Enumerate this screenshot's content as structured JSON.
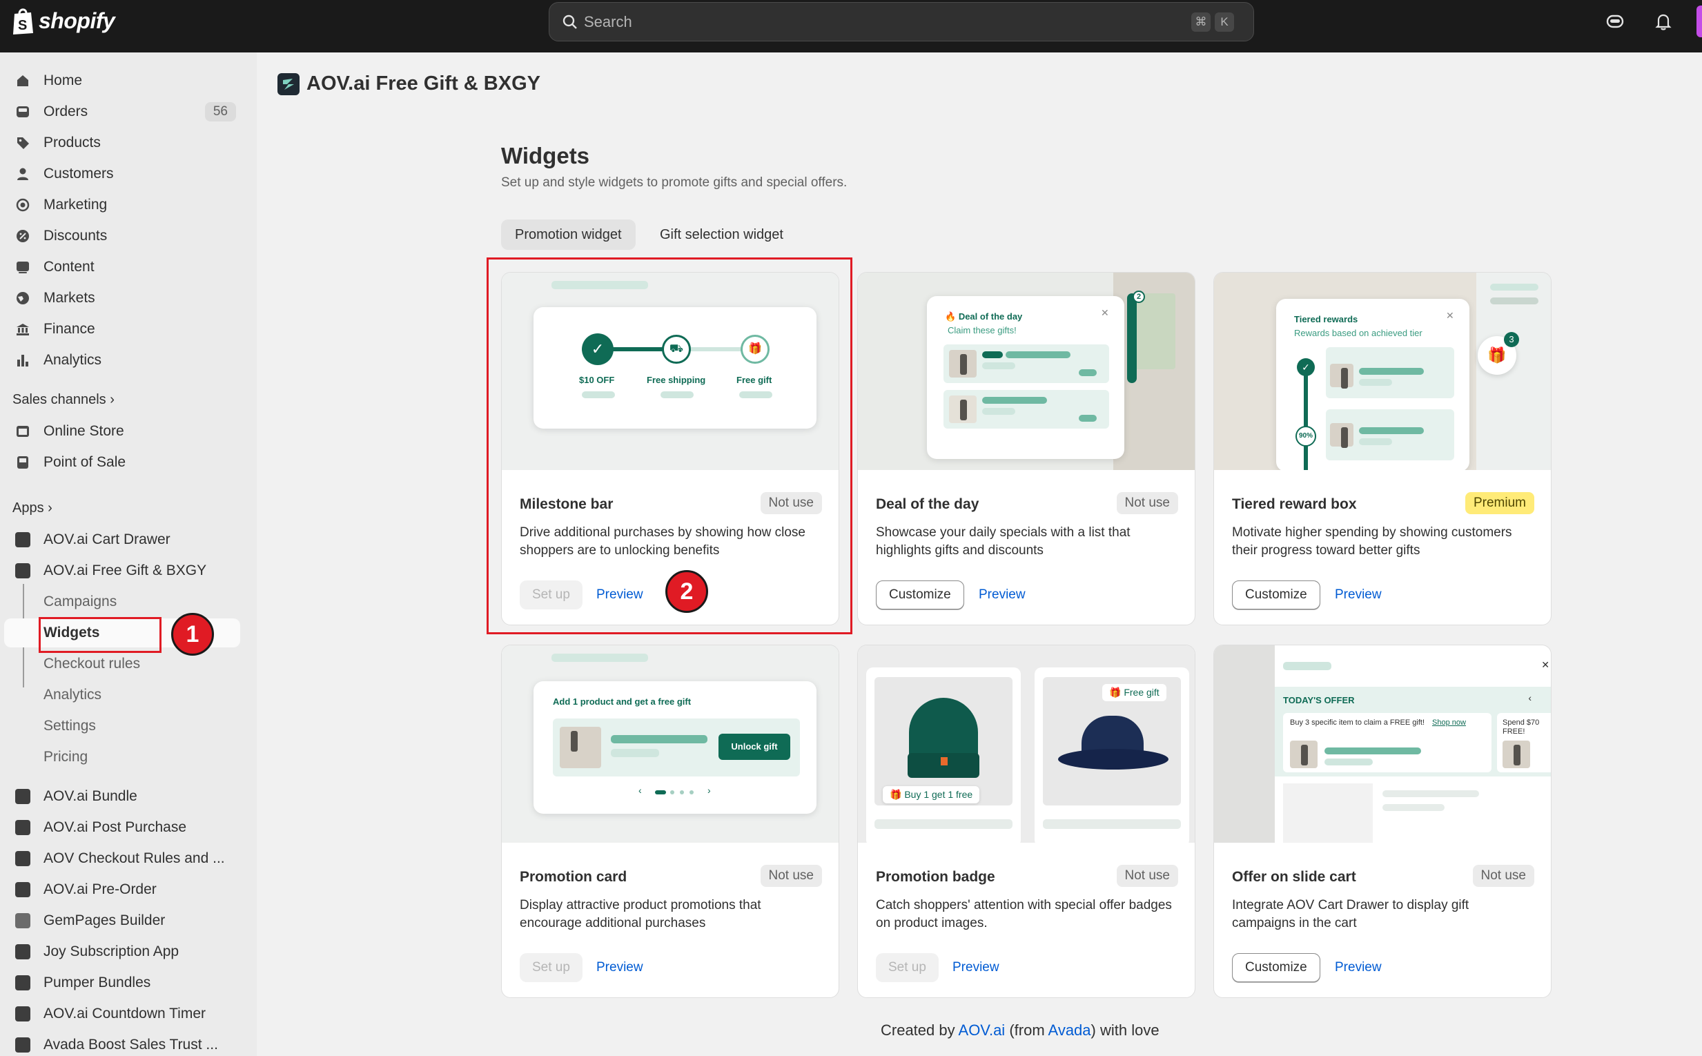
{
  "topbar": {
    "brand": "shopify",
    "search_placeholder": "Search",
    "shortcut_key1": "⌘",
    "shortcut_key2": "K"
  },
  "sidebar": {
    "main_items": [
      {
        "label": "Home",
        "icon": "home-icon"
      },
      {
        "label": "Orders",
        "icon": "inbox-icon",
        "count": "56"
      },
      {
        "label": "Products",
        "icon": "tag-icon"
      },
      {
        "label": "Customers",
        "icon": "person-icon"
      },
      {
        "label": "Marketing",
        "icon": "target-icon"
      },
      {
        "label": "Discounts",
        "icon": "discount-icon"
      },
      {
        "label": "Content",
        "icon": "content-icon"
      },
      {
        "label": "Markets",
        "icon": "globe-icon"
      },
      {
        "label": "Finance",
        "icon": "bank-icon"
      },
      {
        "label": "Analytics",
        "icon": "chart-bars-icon"
      }
    ],
    "sales_channels_label": "Sales channels",
    "sales_channels": [
      {
        "label": "Online Store"
      },
      {
        "label": "Point of Sale"
      }
    ],
    "apps_label": "Apps",
    "apps": [
      {
        "label": "AOV.ai Cart Drawer"
      },
      {
        "label": "AOV.ai Free Gift & BXGY"
      }
    ],
    "app_subitems": [
      {
        "label": "Campaigns"
      },
      {
        "label": "Widgets"
      },
      {
        "label": "Checkout rules"
      },
      {
        "label": "Analytics"
      },
      {
        "label": "Settings"
      },
      {
        "label": "Pricing"
      }
    ],
    "more_apps": [
      {
        "label": "AOV.ai Bundle"
      },
      {
        "label": "AOV.ai Post Purchase"
      },
      {
        "label": "AOV Checkout Rules and ..."
      },
      {
        "label": "AOV.ai Pre-Order"
      },
      {
        "label": "GemPages Builder"
      },
      {
        "label": "Joy Subscription App"
      },
      {
        "label": "Pumper Bundles"
      },
      {
        "label": "AOV.ai Countdown Timer"
      },
      {
        "label": "Avada Boost Sales Trust ..."
      }
    ]
  },
  "main": {
    "app_title": "AOV.ai Free Gift & BXGY",
    "heading": "Widgets",
    "subheading": "Set up and style widgets to promote gifts and special offers.",
    "tabs": [
      {
        "label": "Promotion widget",
        "selected": true
      },
      {
        "label": "Gift selection widget",
        "selected": false
      }
    ],
    "cards": [
      {
        "title": "Milestone bar",
        "status": "Not use",
        "description": "Drive additional purchases by showing how close shoppers are to unlocking benefits",
        "primary": "Set up",
        "primary_enabled": false,
        "secondary": "Preview"
      },
      {
        "title": "Deal of the day",
        "status": "Not use",
        "description": "Showcase your daily specials with a list that highlights gifts and discounts",
        "primary": "Customize",
        "primary_enabled": true,
        "secondary": "Preview"
      },
      {
        "title": "Tiered reward box",
        "status": "Premium",
        "description": "Motivate higher spending by showing customers their progress toward better gifts",
        "primary": "Customize",
        "primary_enabled": true,
        "secondary": "Preview"
      },
      {
        "title": "Promotion card",
        "status": "Not use",
        "description": "Display attractive product promotions that encourage additional purchases",
        "primary": "Set up",
        "primary_enabled": false,
        "secondary": "Preview"
      },
      {
        "title": "Promotion badge",
        "status": "Not use",
        "description": "Catch shoppers' attention with special offer badges on product images.",
        "primary": "Set up",
        "primary_enabled": false,
        "secondary": "Preview"
      },
      {
        "title": "Offer on slide cart",
        "status": "Not use",
        "description": "Integrate AOV Cart Drawer to display gift campaigns in the cart",
        "primary": "Customize",
        "primary_enabled": true,
        "secondary": "Preview"
      }
    ],
    "thumbs": {
      "milestone": {
        "step1": "$10 OFF",
        "step2": "Free shipping",
        "step3": "Free gift"
      },
      "deal": {
        "title": "Deal of the day",
        "subtitle": "Claim these gifts!",
        "badge": "2"
      },
      "tiered": {
        "title": "Tiered rewards",
        "subtitle": "Rewards based on achieved tier",
        "badge": "3",
        "percent": "90%"
      },
      "promo_card": {
        "title": "Add 1 product and get a free gift",
        "button": "Unlock gift"
      },
      "promo_badge": {
        "badge1": "Buy 1 get 1 free",
        "badge2": "Free gift"
      },
      "slide_cart": {
        "title": "TODAY'S OFFER",
        "offer": "Buy 3 specific item to claim a FREE gift!",
        "link": "Shop now",
        "offer2": "Spend $70 FREE!"
      }
    },
    "footer": {
      "prefix": "Created by ",
      "link1": "AOV.ai",
      "middle1": " (from ",
      "link2": "Avada",
      "suffix": ") with love"
    }
  },
  "annotations": {
    "one": "1",
    "two": "2"
  },
  "colors": {
    "accent_red": "#e01b24",
    "link_blue": "#005bd3",
    "brand_green": "#0f6b55"
  }
}
